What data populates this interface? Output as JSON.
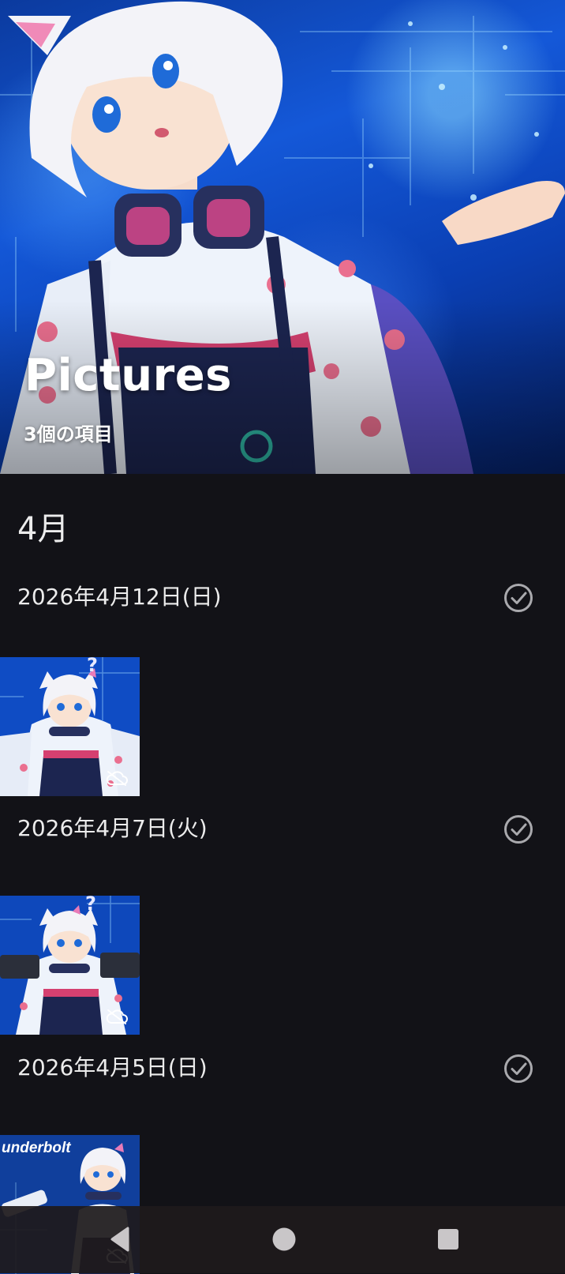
{
  "album": {
    "title": "Pictures",
    "item_count": "3個の項目"
  },
  "month_heading": "4月",
  "groups": [
    {
      "date": "2026年4月12日(日)",
      "photos": [
        {
          "cloud_status": "cloud-off-icon"
        }
      ]
    },
    {
      "date": "2026年4月7日(火)",
      "photos": [
        {
          "cloud_status": "cloud-off-icon"
        }
      ]
    },
    {
      "date": "2026年4月5日(日)",
      "photos": [
        {
          "cloud_status": "cloud-off-icon",
          "overlay_text": "underbolt"
        }
      ]
    }
  ],
  "icons": {
    "group_select": "check-circle-icon",
    "nav_back": "back-triangle-icon",
    "nav_home": "home-circle-icon",
    "nav_recents": "recents-square-icon"
  },
  "colors": {
    "background": "#121217",
    "text": "#ececec",
    "icon_gray": "#a9a9ad",
    "nav_bar": "#1e1a1c"
  }
}
